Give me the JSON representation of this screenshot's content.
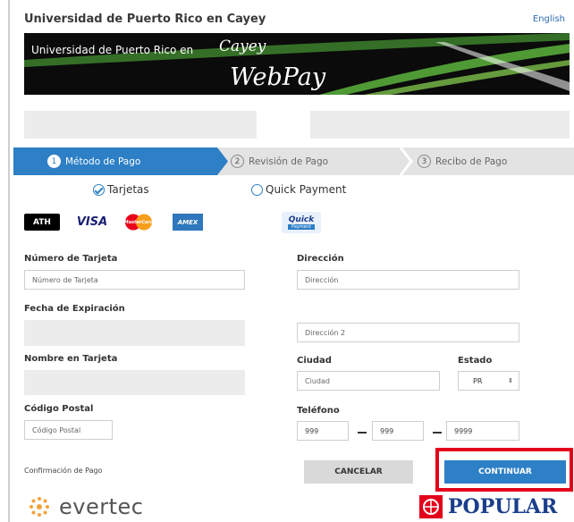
{
  "header": {
    "title": "Universidad de Puerto Rico en Cayey",
    "language_link": "English"
  },
  "banner": {
    "line1": "Universidad de Puerto Rico en",
    "script": "Cayey",
    "webpay": "WebPay"
  },
  "steps": [
    {
      "number": "1",
      "label": "Método de Pago",
      "active": true
    },
    {
      "number": "2",
      "label": "Revisión de Pago",
      "active": false
    },
    {
      "number": "3",
      "label": "Recibo de Pago",
      "active": false
    }
  ],
  "payment_options": {
    "cards_label": "Tarjetas",
    "quick_label": "Quick Payment",
    "selected": "Tarjetas"
  },
  "card_logos": {
    "ath": "ATH",
    "visa": "VISA",
    "mastercard": "MasterCard",
    "amex": "AMEX",
    "quick_top": "Quick",
    "quick_bottom": "Payment"
  },
  "form": {
    "card_number_label": "Número de Tarjeta",
    "card_number_placeholder": "Número de Tarjeta",
    "expiration_label": "Fecha de Expiración",
    "name_label": "Nombre en Tarjeta",
    "zip_label": "Código Postal",
    "zip_placeholder": "Código Postal",
    "address_label": "Dirección",
    "address_placeholder": "Dirección",
    "address2_placeholder": "Dirección 2",
    "city_label": "Ciudad",
    "city_placeholder": "Ciudad",
    "state_label": "Estado",
    "state_value": "PR",
    "phone_label": "Teléfono",
    "phone_part1": "999",
    "phone_part2": "999",
    "phone_part3": "9999",
    "confirmation_label": "Confirmación de Pago"
  },
  "buttons": {
    "cancel": "CANCELAR",
    "continue": "CONTINUAR"
  },
  "footer": {
    "evertec": "evertec",
    "popular": "POPULAR"
  },
  "colors": {
    "primary": "#2d7fc6",
    "highlight": "#e3001b",
    "popular_blue": "#1a3e8c"
  }
}
